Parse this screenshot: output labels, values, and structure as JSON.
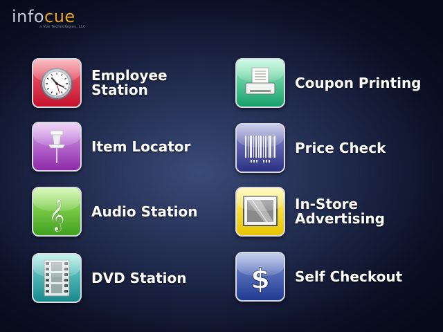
{
  "brand": {
    "logo_prefix": "info",
    "logo_suffix": "cue",
    "logo_tagline": "a Vue Technologies, LLC"
  },
  "tiles": {
    "employee_station": {
      "label": "Employee\nStation",
      "icon": "clock-icon",
      "color": "#d01e3a"
    },
    "item_locator": {
      "label": "Item Locator",
      "icon": "pushpin-icon",
      "color": "#a844c4"
    },
    "audio_station": {
      "label": "Audio Station",
      "icon": "treble-clef-icon",
      "color": "#4fb42a"
    },
    "dvd_station": {
      "label": "DVD Station",
      "icon": "film-strip-icon",
      "color": "#1f9a9a"
    },
    "coupon_printing": {
      "label": "Coupon Printing",
      "icon": "printer-icon",
      "color": "#1fae74"
    },
    "price_check": {
      "label": "Price Check",
      "icon": "barcode-icon",
      "color": "#3a3f96"
    },
    "in_store_advertising": {
      "label": "In-Store\nAdvertising",
      "icon": "picture-frame-icon",
      "color": "#f0d000"
    },
    "self_checkout": {
      "label": "Self Checkout",
      "icon": "dollar-icon",
      "color": "#2a4aa0"
    }
  }
}
